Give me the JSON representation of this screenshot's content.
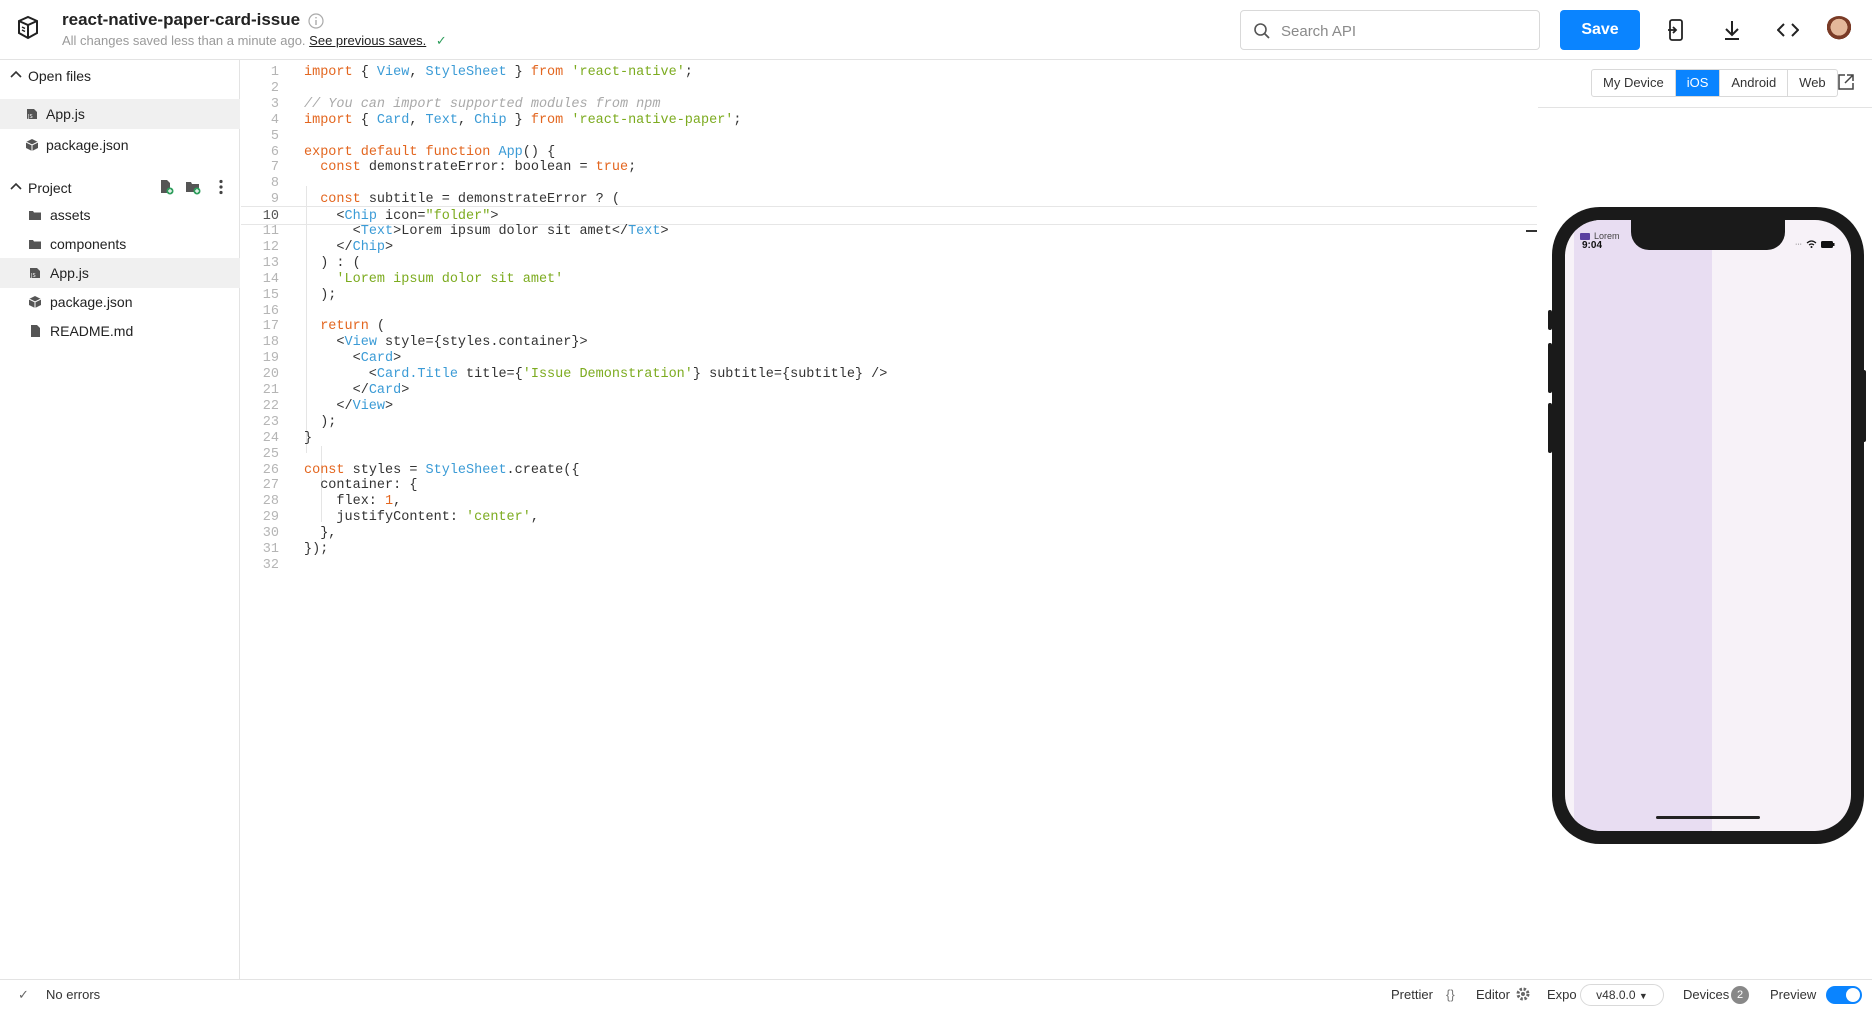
{
  "header": {
    "project_title": "react-native-paper-card-issue",
    "saved_status": "All changes saved less than a minute ago.",
    "previous_saves_link": "See previous saves.",
    "search_placeholder": "Search API",
    "save_label": "Save"
  },
  "sidebar": {
    "open_files_label": "Open files",
    "open_files": [
      {
        "label": "App.js",
        "icon": "js-file-icon",
        "active": true
      },
      {
        "label": "package.json",
        "icon": "package-icon",
        "active": false
      }
    ],
    "project_label": "Project",
    "project_files": [
      {
        "label": "assets",
        "icon": "folder-icon",
        "active": false
      },
      {
        "label": "components",
        "icon": "folder-icon",
        "active": false
      },
      {
        "label": "App.js",
        "icon": "js-file-icon",
        "active": true
      },
      {
        "label": "package.json",
        "icon": "package-icon",
        "active": false
      },
      {
        "label": "README.md",
        "icon": "file-icon",
        "active": false
      }
    ]
  },
  "editor": {
    "current_line": 10,
    "lines": [
      "import { View, StyleSheet } from 'react-native';",
      "",
      "// You can import supported modules from npm",
      "import { Card, Text, Chip } from 'react-native-paper';",
      "",
      "export default function App() {",
      "  const demonstrateError: boolean = true;",
      "",
      "  const subtitle = demonstrateError ? (",
      "    <Chip icon=\"folder\">",
      "      <Text>Lorem ipsum dolor sit amet</Text>",
      "    </Chip>",
      "  ) : (",
      "    'Lorem ipsum dolor sit amet'",
      "  );",
      "",
      "  return (",
      "    <View style={styles.container}>",
      "      <Card>",
      "        <Card.Title title={'Issue Demonstration'} subtitle={subtitle} />",
      "      </Card>",
      "    </View>",
      "  );",
      "}",
      "",
      "const styles = StyleSheet.create({",
      "  container: {",
      "    flex: 1,",
      "    justifyContent: 'center',",
      "  },",
      "});",
      ""
    ]
  },
  "preview": {
    "platforms": [
      "My Device",
      "iOS",
      "Android",
      "Web"
    ],
    "active_platform": "iOS",
    "device_time": "9:04",
    "chip_text": "Lorem"
  },
  "footer": {
    "errors": "No errors",
    "prettier": "Prettier",
    "prettier_symbol": "{}",
    "editor": "Editor",
    "expo": "Expo",
    "sdk_version": "v48.0.0",
    "devices": "Devices",
    "devices_count": "2",
    "preview": "Preview"
  },
  "colors": {
    "accent": "#0a84ff",
    "keyword": "#e3661f",
    "type": "#3b9bd6",
    "string": "#7cab1f",
    "comment": "#a9a9a9"
  }
}
